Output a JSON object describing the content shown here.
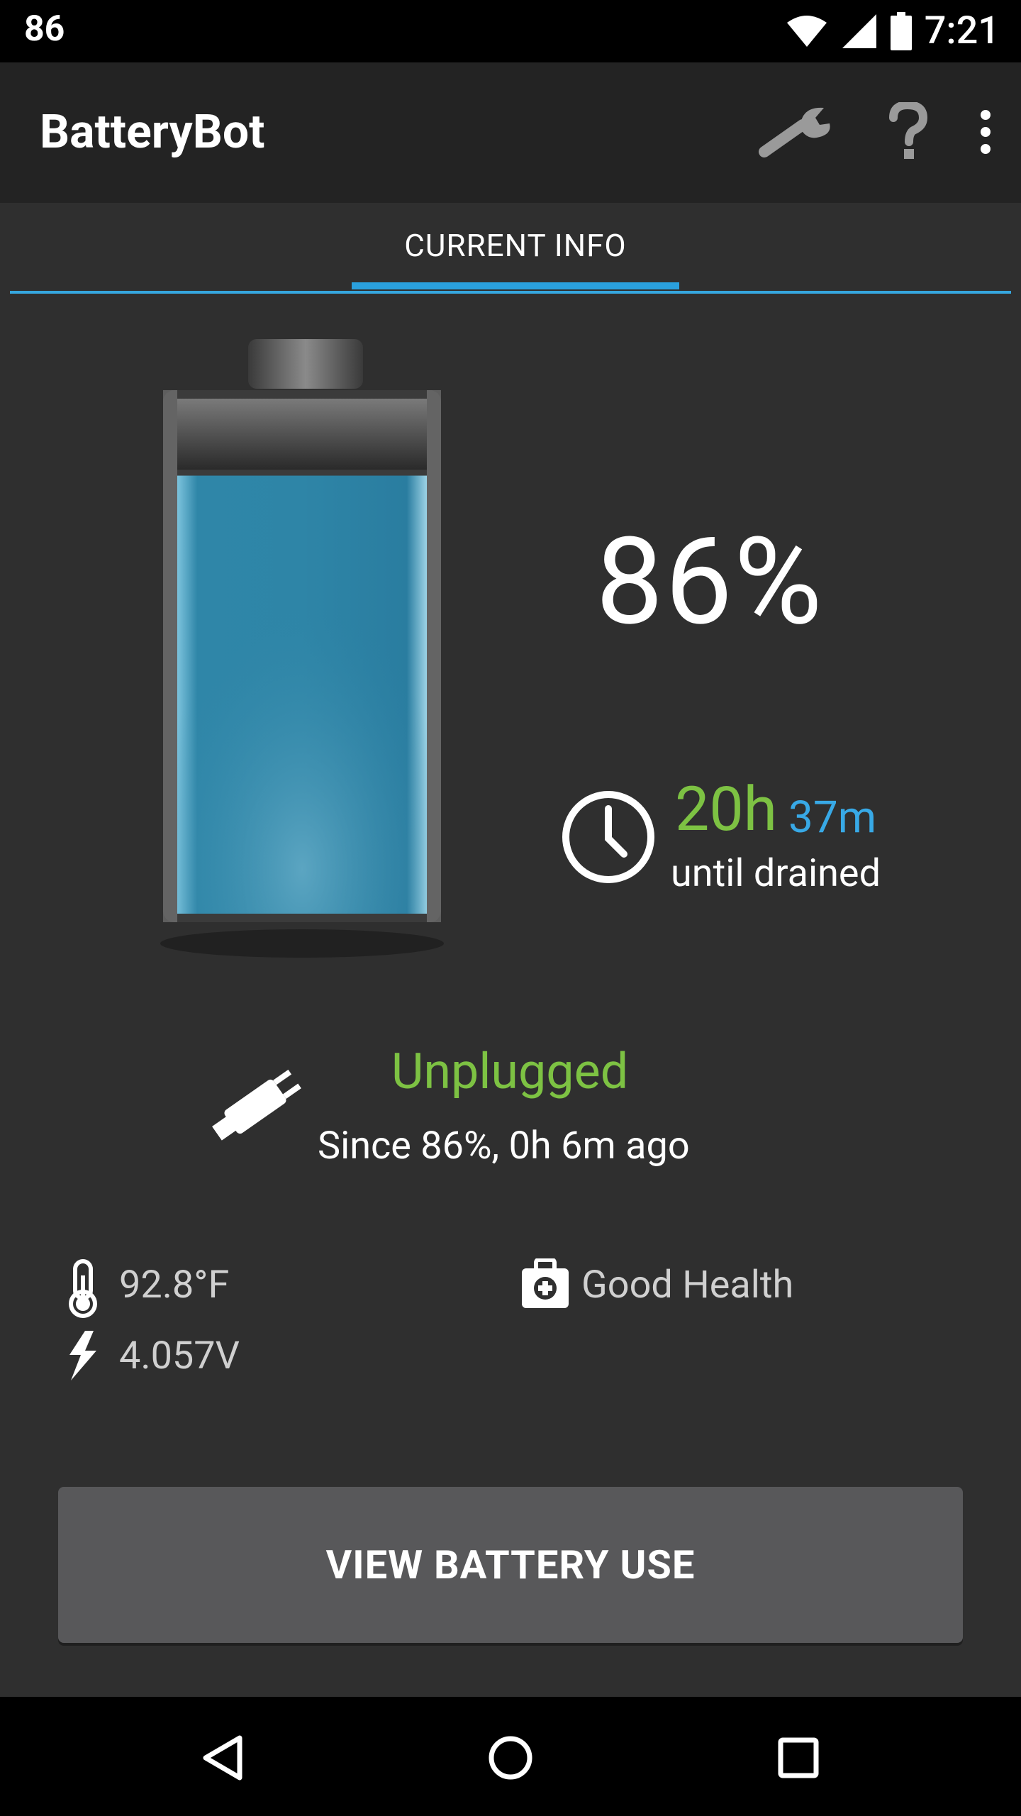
{
  "status_bar": {
    "battery_level": "86",
    "time": "7:21"
  },
  "app_bar": {
    "title": "BatteryBot"
  },
  "tabs": [
    {
      "label": "CURRENT INFO",
      "active": true
    }
  ],
  "battery": {
    "level_percent": 86,
    "percent_text": "86%"
  },
  "drain": {
    "hours": "20h",
    "minutes": "37m",
    "label": "until drained"
  },
  "charging": {
    "state": "Unplugged",
    "since": "Since 86%, 0h 6m ago"
  },
  "stats": {
    "temperature": "92.8°F",
    "voltage": "4.057V",
    "health": "Good Health"
  },
  "button": {
    "label": "VIEW BATTERY USE"
  },
  "colors": {
    "accent_blue": "#36a7df",
    "green": "#7dc243",
    "background": "#2f2f2f"
  },
  "icons": [
    "wifi-icon",
    "signal-icon",
    "battery-status-icon",
    "wrench-icon",
    "help-icon",
    "overflow-menu-icon",
    "clock-icon",
    "plug-icon",
    "thermometer-icon",
    "bolt-icon",
    "medkit-icon",
    "back-icon",
    "home-icon",
    "recents-icon"
  ]
}
